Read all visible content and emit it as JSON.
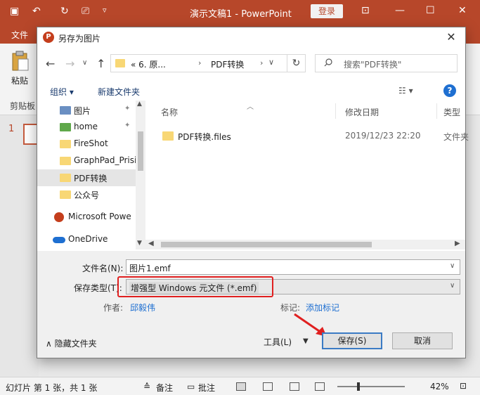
{
  "ppt": {
    "title": "演示文稿1  -  PowerPoint",
    "login": "登录",
    "tab_file": "文件",
    "paste_label": "粘贴",
    "clipboard_label": "剪贴板",
    "slide_number": "1",
    "status_slides": "幻灯片 第 1 张，共 1 张",
    "status_notes": "备注",
    "status_comments": "批注",
    "zoom": "42%"
  },
  "dialog": {
    "title": "另存为图片",
    "address": {
      "seg1": "«  6. 原...",
      "seg2": "PDF转换"
    },
    "search_placeholder": "搜索\"PDF转换\"",
    "toolbar": {
      "organize": "组织 ▾",
      "new_folder": "新建文件夹"
    },
    "nav_items": [
      {
        "label": "图片"
      },
      {
        "label": "home"
      },
      {
        "label": "FireShot"
      },
      {
        "label": "GraphPad_Prisi"
      },
      {
        "label": "PDF转换"
      },
      {
        "label": "公众号"
      },
      {
        "label": "Microsoft Powe"
      },
      {
        "label": "OneDrive"
      }
    ],
    "columns": {
      "name": "名称",
      "date": "修改日期",
      "type": "类型"
    },
    "files": [
      {
        "name": "PDF转换.files",
        "date": "2019/12/23 22:20",
        "type": "文件夹"
      }
    ],
    "filename_label": "文件名(N):",
    "filename_value": "图片1.emf",
    "filetype_label": "保存类型(T):",
    "filetype_value": "增强型 Windows 元文件 (*.emf)",
    "author_label": "作者:",
    "author_value": "邱毅伟",
    "tags_label": "标记:",
    "tags_value": "添加标记",
    "hide_folders": "隐藏文件夹",
    "tools": "工具(L)",
    "save": "保存(S)",
    "cancel": "取消"
  }
}
